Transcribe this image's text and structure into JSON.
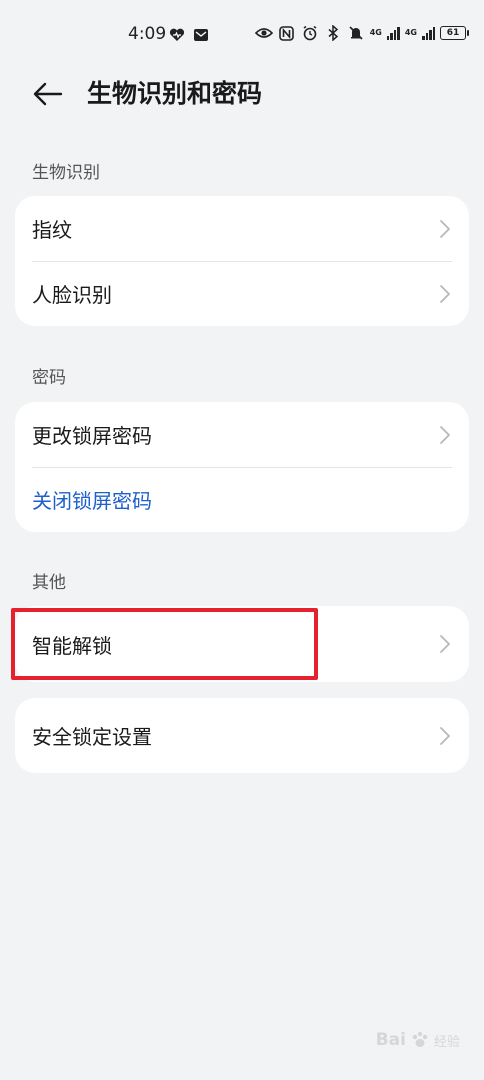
{
  "status_bar": {
    "time": "4:09",
    "net_label_1": "4G",
    "net_label_2": "4G",
    "battery": "61"
  },
  "header": {
    "title": "生物识别和密码"
  },
  "sections": {
    "biometrics": {
      "label": "生物识别",
      "items": [
        "指纹",
        "人脸识别"
      ]
    },
    "password": {
      "label": "密码",
      "items": [
        "更改锁屏密码",
        "关闭锁屏密码"
      ]
    },
    "other": {
      "label": "其他",
      "items": [
        "智能解锁"
      ]
    },
    "security_lock": {
      "items": [
        "安全锁定设置"
      ]
    }
  },
  "watermark": {
    "brand": "Bai",
    "sub": "经验"
  },
  "colors": {
    "background": "#f1f3f5",
    "link": "#1f5fcc",
    "highlight": "#e5212e"
  }
}
